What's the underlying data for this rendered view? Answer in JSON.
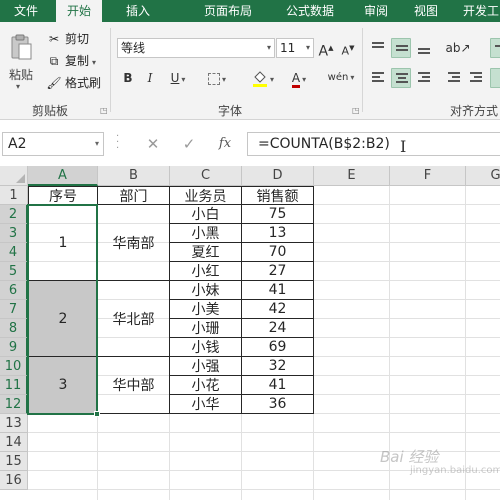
{
  "ribbon_tabs": [
    "文件",
    "开始",
    "插入",
    "页面布局",
    "公式",
    "数据",
    "审阅",
    "视图",
    "开发工"
  ],
  "active_tab_index": 1,
  "clipboard": {
    "paste": "粘贴",
    "cut": "剪切",
    "copy": "复制",
    "format_painter": "格式刷",
    "group_label": "剪贴板"
  },
  "font": {
    "name": "等线",
    "size": "11",
    "bold": "B",
    "italic": "I",
    "underline": "U",
    "phonetic": "wén",
    "font_color_label": "A",
    "grow_label": "A",
    "shrink_label": "A",
    "group_label": "字体",
    "fill_color": "#ffff00",
    "font_color": "#c00000"
  },
  "alignment": {
    "group_label": "对齐方式"
  },
  "formula_bar": {
    "name_box": "A2",
    "cancel": "✕",
    "enter": "✓",
    "fx": "fx",
    "formula": "=COUNTA(B$2:B2)"
  },
  "columns": [
    "A",
    "B",
    "C",
    "D",
    "E",
    "F",
    "G"
  ],
  "selected_column": "A",
  "rows": [
    "1",
    "2",
    "3",
    "4",
    "5",
    "6",
    "7",
    "8",
    "9",
    "10",
    "11",
    "12",
    "13",
    "14",
    "15",
    "16"
  ],
  "selected_rows": [
    "2",
    "3",
    "4",
    "5",
    "6",
    "7",
    "8",
    "9",
    "10",
    "11",
    "12"
  ],
  "table": {
    "headers": [
      "序号",
      "部门",
      "业务员",
      "销售额"
    ],
    "groups": [
      {
        "index": "1",
        "dept": "华南部",
        "members": [
          [
            "小白",
            "75"
          ],
          [
            "小黑",
            "13"
          ],
          [
            "夏红",
            "70"
          ],
          [
            "小红",
            "27"
          ]
        ]
      },
      {
        "index": "2",
        "dept": "华北部",
        "members": [
          [
            "小妹",
            "41"
          ],
          [
            "小美",
            "42"
          ],
          [
            "小珊",
            "24"
          ],
          [
            "小钱",
            "69"
          ]
        ]
      },
      {
        "index": "3",
        "dept": "华中部",
        "members": [
          [
            "小强",
            "32"
          ],
          [
            "小花",
            "41"
          ],
          [
            "小华",
            "36"
          ]
        ]
      }
    ]
  },
  "colors": {
    "excel_green": "#217346",
    "merged_fill": "#c8c8c8",
    "selection_green": "#217346"
  },
  "watermark": {
    "line1": "Bai 经验",
    "line2": "jingyan.baidu.com"
  }
}
